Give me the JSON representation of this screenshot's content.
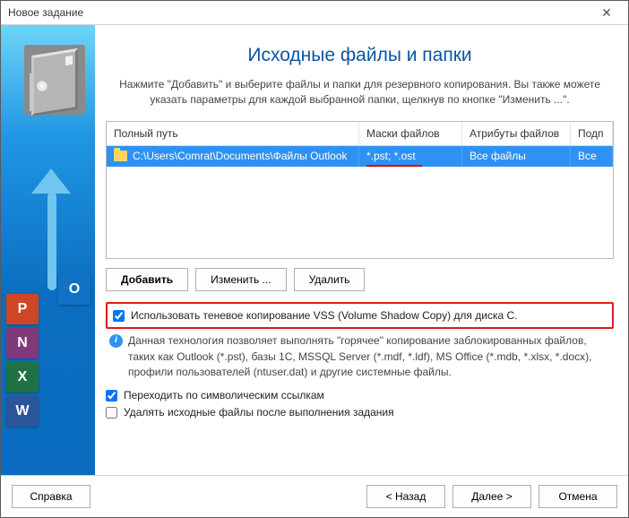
{
  "window": {
    "title": "Новое задание"
  },
  "heading": "Исходные файлы и папки",
  "subtitle": "Нажмите \"Добавить\" и выберите файлы и папки для резервного копирования. Вы также можете указать параметры для каждой выбранной папки, щелкнув по кнопке \"Изменить ...\".",
  "grid": {
    "columns": {
      "path": "Полный путь",
      "mask": "Маски файлов",
      "attr": "Атрибуты файлов",
      "sub": "Подп"
    },
    "rows": [
      {
        "path": "C:\\Users\\Comrat\\Documents\\Файлы Outlook",
        "mask": "*.pst; *.ost",
        "attr": "Все файлы",
        "sub": "Все"
      }
    ]
  },
  "buttons": {
    "add": "Добавить",
    "edit": "Изменить ...",
    "delete": "Удалить"
  },
  "options": {
    "vss": "Использовать теневое копирование VSS (Volume Shadow Copy) для диска C.",
    "vss_checked": true,
    "hint": "Данная технология позволяет выполнять \"горячее\" копирование заблокированных файлов, таких как Outlook (*.pst), базы 1C, MSSQL Server (*.mdf, *.ldf), MS Office (*.mdb, *.xlsx, *.docx), профили пользователей (ntuser.dat) и другие системные файлы.",
    "follow_symlinks": "Переходить по символическим ссылкам",
    "follow_symlinks_checked": true,
    "delete_source": "Удалять исходные файлы после выполнения задания",
    "delete_source_checked": false
  },
  "footer": {
    "help": "Справка",
    "back": "< Назад",
    "next": "Далее >",
    "cancel": "Отмена"
  },
  "tiles": {
    "outlook": "O",
    "powerpoint": "P",
    "onenote": "N",
    "excel": "X",
    "word": "W"
  }
}
